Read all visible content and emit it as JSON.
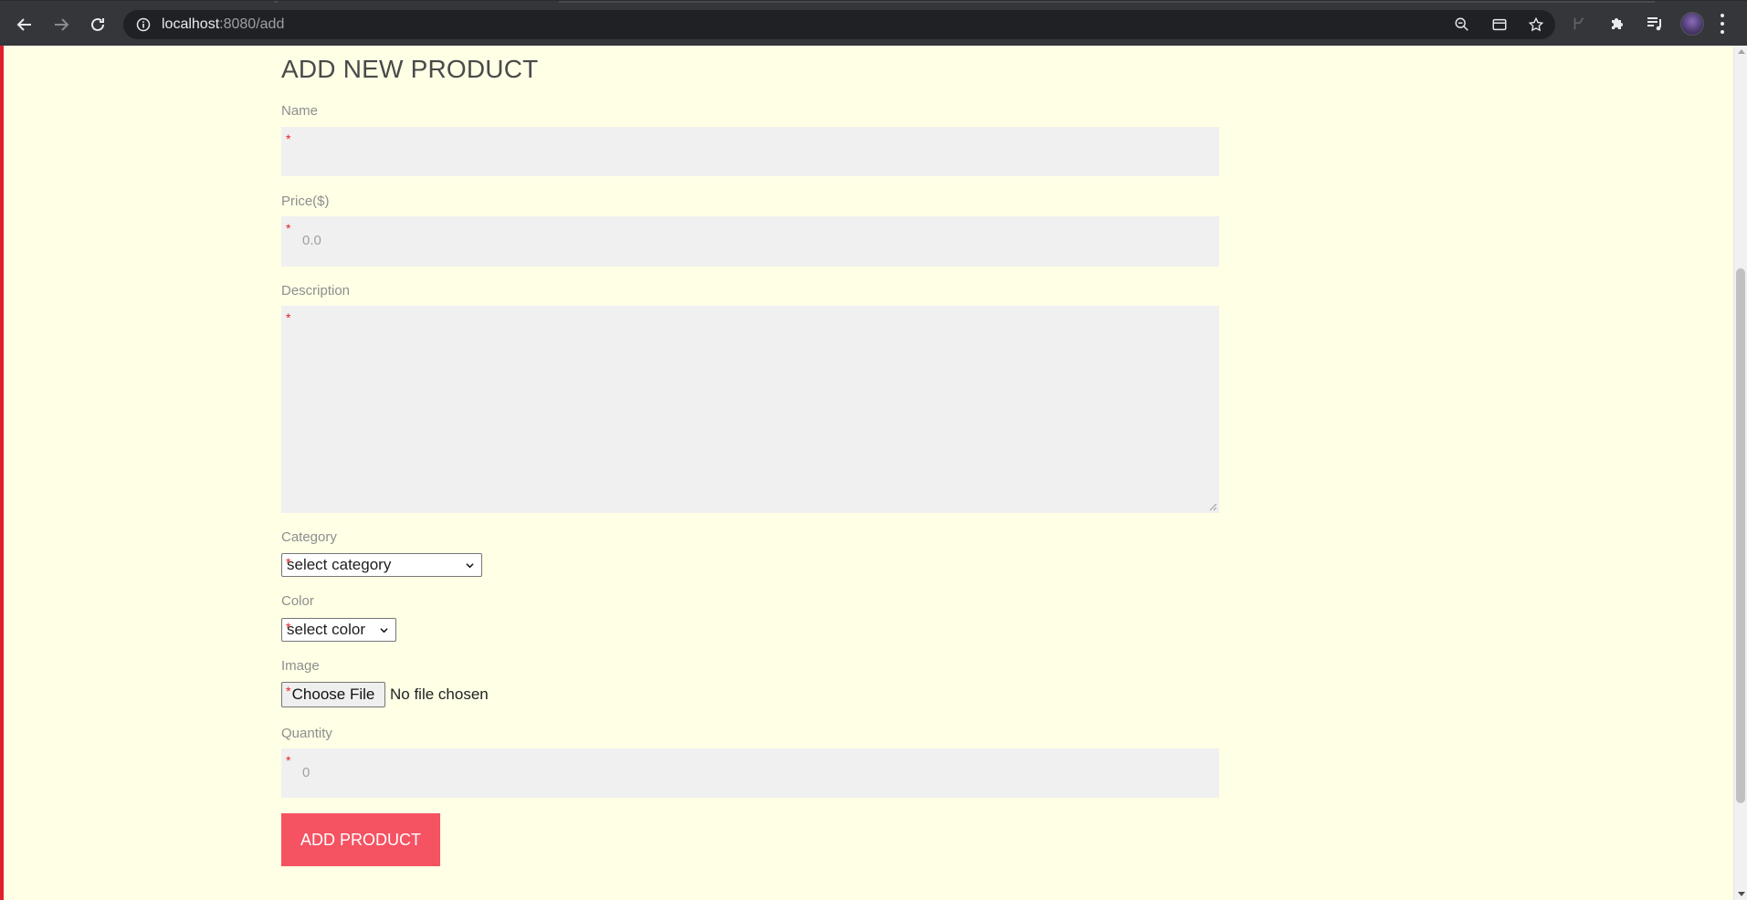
{
  "browser": {
    "url_host": "localhost",
    "url_path": ":8080/add",
    "icons": {
      "back": "arrow-left-icon",
      "forward": "arrow-right-icon",
      "reload": "reload-icon",
      "info": "info-icon",
      "zoom": "zoom-out-icon",
      "reader": "reader-mode-icon",
      "bookmark": "star-icon",
      "extension_disabled": "extension-icon",
      "extensions": "puzzle-icon",
      "media": "media-queue-icon"
    }
  },
  "page": {
    "title": "ADD NEW PRODUCT",
    "background_color": "#ffffe6",
    "accent_color": "#f55262",
    "required_marker": "*"
  },
  "form": {
    "name": {
      "label": "Name",
      "placeholder": ""
    },
    "price": {
      "label": "Price($)",
      "placeholder": "0.0"
    },
    "description": {
      "label": "Description",
      "placeholder": ""
    },
    "category": {
      "label": "Category",
      "selected": "select category"
    },
    "color": {
      "label": "Color",
      "selected": "select color"
    },
    "image": {
      "label": "Image",
      "button_label": "Choose File",
      "status": "No file chosen"
    },
    "quantity": {
      "label": "Quantity",
      "placeholder": "0"
    },
    "submit_label": "ADD PRODUCT"
  }
}
